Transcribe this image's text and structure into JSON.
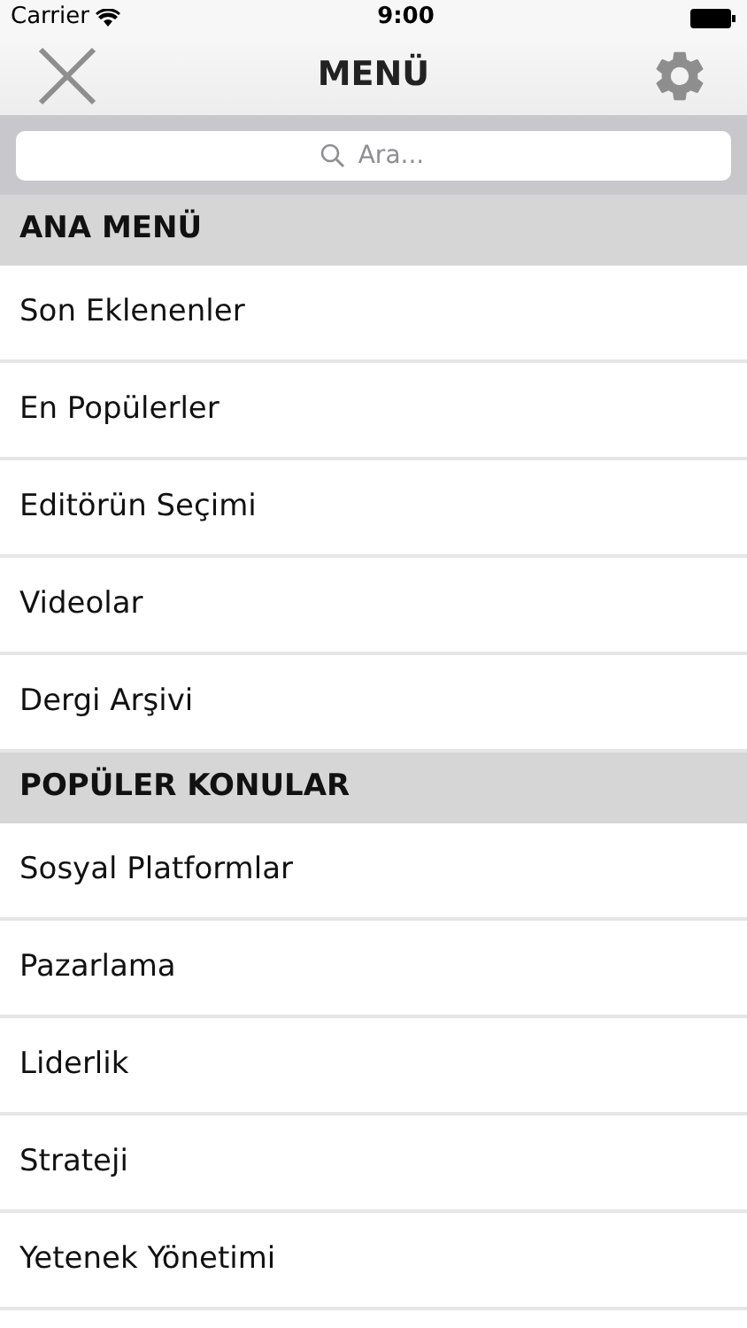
{
  "status_bar": {
    "carrier": "Carrier",
    "time": "9:00"
  },
  "nav": {
    "title": "MENÜ"
  },
  "search": {
    "placeholder": "Ara..."
  },
  "sections": [
    {
      "title": "ANA MENÜ",
      "items": [
        "Son Eklenenler",
        "En Popülerler",
        "Editörün Seçimi",
        "Videolar",
        "Dergi Arşivi"
      ]
    },
    {
      "title": "POPÜLER KONULAR",
      "items": [
        "Sosyal Platformlar",
        "Pazarlama",
        "Liderlik",
        "Strateji",
        "Yetenek Yönetimi"
      ]
    }
  ]
}
